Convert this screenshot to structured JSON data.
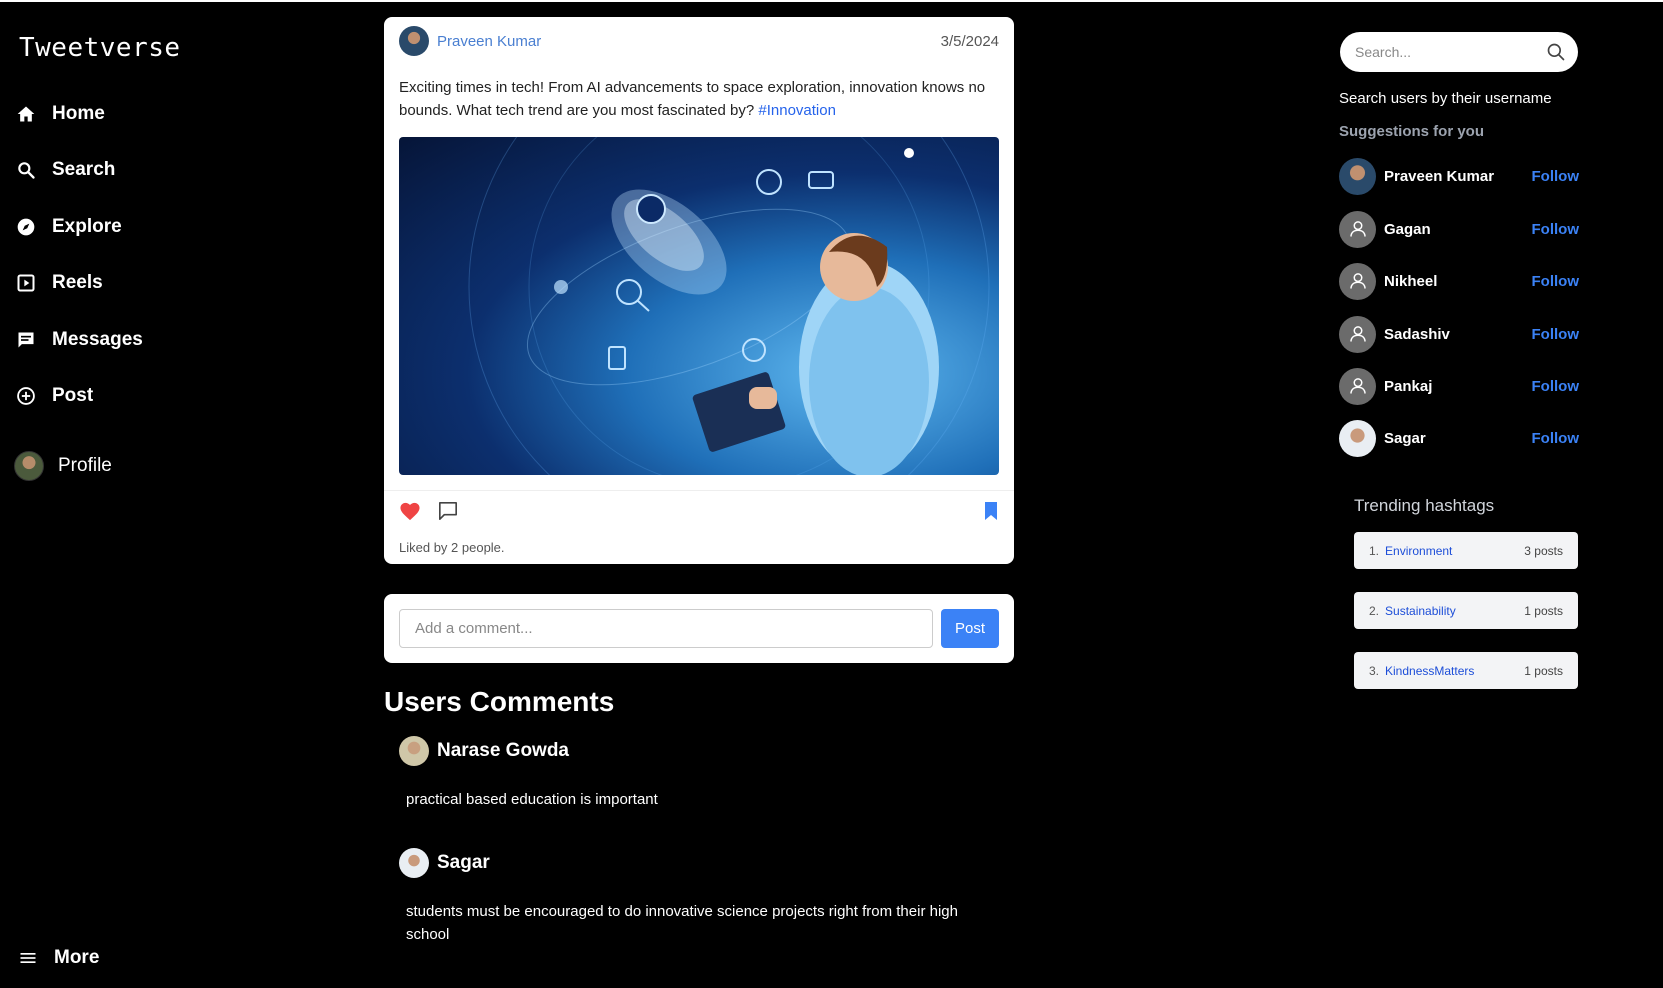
{
  "app": {
    "title": "Tweetverse"
  },
  "nav": {
    "items": [
      {
        "label": "Home",
        "icon": "home-icon"
      },
      {
        "label": "Search",
        "icon": "search-icon"
      },
      {
        "label": "Explore",
        "icon": "compass-icon"
      },
      {
        "label": "Reels",
        "icon": "play-square-icon"
      },
      {
        "label": "Messages",
        "icon": "message-icon"
      },
      {
        "label": "Post",
        "icon": "plus-circle-icon"
      },
      {
        "label": "Profile",
        "icon": "avatar"
      }
    ],
    "more": "More"
  },
  "post": {
    "author": "Praveen Kumar",
    "date": "3/5/2024",
    "text": "Exciting times in tech! From AI advancements to space exploration, innovation knows no bounds. What tech trend are you most fascinated by?",
    "hashtag": "#Innovation",
    "likes": "Liked by 2 people."
  },
  "comment_form": {
    "placeholder": "Add a comment...",
    "button": "Post"
  },
  "comments": {
    "title": "Users Comments",
    "items": [
      {
        "name": "Narase Gowda",
        "text": "practical based education is important"
      },
      {
        "name": "Sagar",
        "text": "students must be encouraged to do innovative science projects right from their high school"
      }
    ]
  },
  "search": {
    "placeholder": "Search...",
    "hint": "Search users by their username"
  },
  "suggestions": {
    "title": "Suggestions for you",
    "follow_label": "Follow",
    "users": [
      {
        "name": "Praveen Kumar"
      },
      {
        "name": "Gagan"
      },
      {
        "name": "Nikheel"
      },
      {
        "name": "Sadashiv"
      },
      {
        "name": "Pankaj"
      },
      {
        "name": "Sagar"
      }
    ]
  },
  "trending": {
    "title": "Trending hashtags",
    "items": [
      {
        "num": "1.",
        "tag": "Environment",
        "count": "3 posts"
      },
      {
        "num": "2.",
        "tag": "Sustainability",
        "count": "1 posts"
      },
      {
        "num": "3.",
        "tag": "KindnessMatters",
        "count": "1 posts"
      }
    ]
  },
  "colors": {
    "accent": "#3b82f6",
    "like": "#ef4444",
    "link": "#2563eb"
  }
}
